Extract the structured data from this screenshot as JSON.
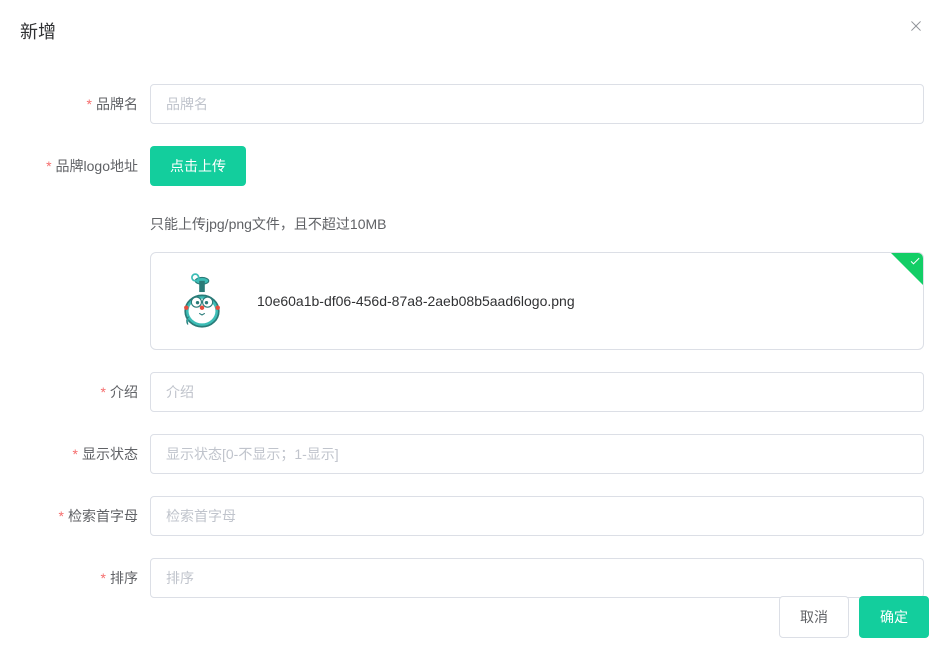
{
  "dialog": {
    "title": "新增"
  },
  "form": {
    "brandName": {
      "label": "品牌名",
      "placeholder": "品牌名"
    },
    "logo": {
      "label": "品牌logo地址",
      "button": "点击上传",
      "tip": "只能上传jpg/png文件，且不超过10MB",
      "filename": "10e60a1b-df06-456d-87a8-2aeb08b5aad6logo.png"
    },
    "intro": {
      "label": "介绍",
      "placeholder": "介绍"
    },
    "showStatus": {
      "label": "显示状态",
      "placeholder": "显示状态[0-不显示；1-显示]"
    },
    "firstLetter": {
      "label": "检索首字母",
      "placeholder": "检索首字母"
    },
    "sort": {
      "label": "排序",
      "placeholder": "排序"
    }
  },
  "footer": {
    "cancel": "取消",
    "confirm": "确定"
  }
}
